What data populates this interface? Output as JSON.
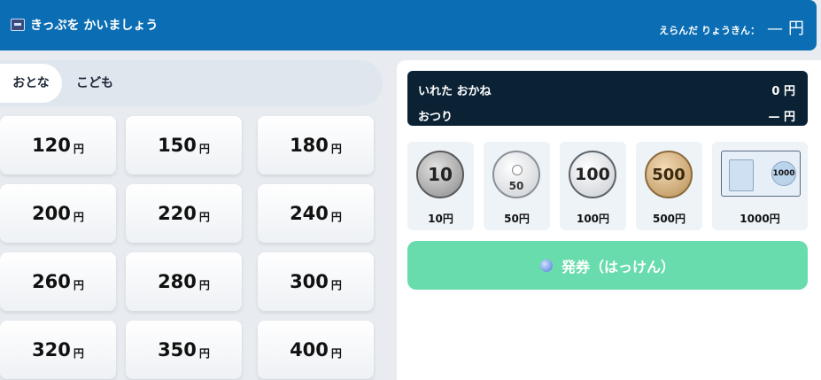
{
  "header": {
    "title": "きっぷを かいましょう",
    "selected_label": "えらんだ りょうきん：",
    "selected_value": "—",
    "selected_unit": "円"
  },
  "tabs": [
    {
      "label": "おとな",
      "active": true
    },
    {
      "label": "こども",
      "active": false
    }
  ],
  "fares": [
    {
      "amount": "120",
      "unit": "円"
    },
    {
      "amount": "150",
      "unit": "円"
    },
    {
      "amount": "180",
      "unit": "円"
    },
    {
      "amount": "200",
      "unit": "円"
    },
    {
      "amount": "220",
      "unit": "円"
    },
    {
      "amount": "240",
      "unit": "円"
    },
    {
      "amount": "260",
      "unit": "円"
    },
    {
      "amount": "280",
      "unit": "円"
    },
    {
      "amount": "300",
      "unit": "円"
    },
    {
      "amount": "320",
      "unit": "円"
    },
    {
      "amount": "350",
      "unit": "円"
    },
    {
      "amount": "400",
      "unit": "円"
    }
  ],
  "display": {
    "inserted_label": "いれた おかね",
    "inserted_value": "0 円",
    "change_label": "おつり",
    "change_value": "— 円"
  },
  "money": [
    {
      "face": "10",
      "label": "10円",
      "icon": "coin-10-icon"
    },
    {
      "face": "50",
      "label": "50円",
      "icon": "coin-50-icon"
    },
    {
      "face": "100",
      "label": "100円",
      "icon": "coin-100-icon"
    },
    {
      "face": "500",
      "label": "500円",
      "icon": "coin-500-icon"
    },
    {
      "face": "1000",
      "label": "1000円",
      "icon": "bill-1000-icon"
    }
  ],
  "issue_button": {
    "label": "発券（はっけん）"
  },
  "colors": {
    "header": "#0b6db3",
    "display": "#0b2235",
    "issue": "#68dcad"
  }
}
